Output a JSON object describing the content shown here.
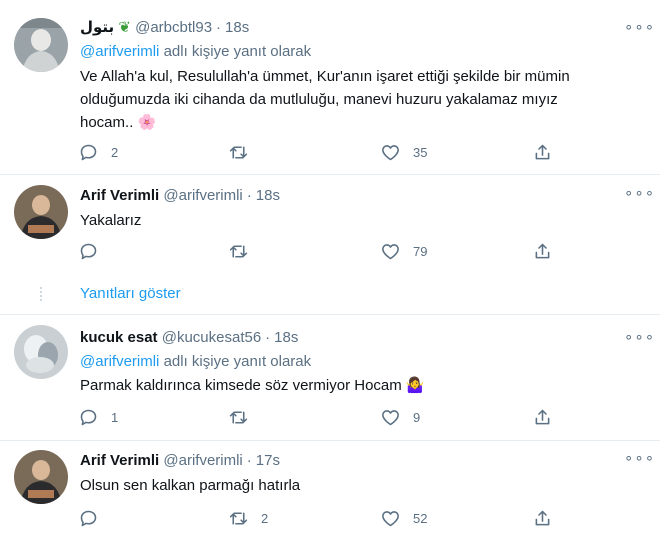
{
  "tweets": [
    {
      "name": "بتول",
      "handle": "@arbcbtl93",
      "dot": "·",
      "time": "18s",
      "reply_mention": "@arifverimli",
      "reply_suffix": " adlı kişiye yanıt olarak",
      "text": "Ve Allah'a kul, Resulullah'a ümmet, Kur'anın işaret ettiği şekilde bir mümin olduğumuzda iki cihanda da mutluluğu, manevi huzuru yakalamaz mıyız hocam.. 🌸",
      "replies": "2",
      "retweets": "",
      "likes": "35"
    },
    {
      "name": "Arif Verimli",
      "handle": "@arifverimli",
      "dot": "·",
      "time": "18s",
      "text": "Yakalarız",
      "replies": "",
      "retweets": "",
      "likes": "79"
    },
    {
      "name": "kucuk esat",
      "handle": "@kucukesat56",
      "dot": "·",
      "time": "18s",
      "reply_mention": "@arifverimli",
      "reply_suffix": " adlı kişiye yanıt olarak",
      "text": "Parmak kaldırınca kimsede söz vermiyor Hocam 🤷‍♀️",
      "replies": "1",
      "retweets": "",
      "likes": "9"
    },
    {
      "name": "Arif Verimli",
      "handle": "@arifverimli",
      "dot": "·",
      "time": "17s",
      "text": "Olsun sen kalkan parmağı hatırla",
      "replies": "",
      "retweets": "2",
      "likes": "52"
    }
  ],
  "show_replies": "Yanıtları göster",
  "more_glyph": "∘∘∘",
  "icons": {
    "reply": "speech-bubble-icon",
    "retweet": "retweet-arrows-icon",
    "like": "heart-icon",
    "share": "share-upload-icon",
    "more": "more-options-icon"
  },
  "colors": {
    "link": "#1d9bf0",
    "muted": "#5b7083",
    "text": "#0f1419"
  }
}
